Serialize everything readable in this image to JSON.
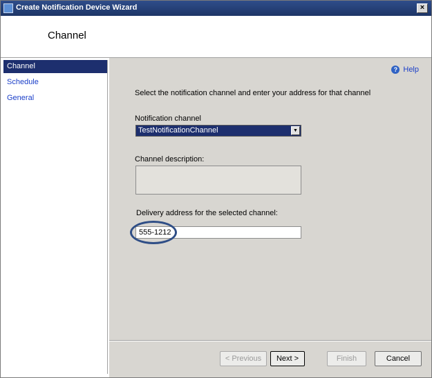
{
  "window": {
    "title": "Create Notification Device Wizard",
    "close_label": "×"
  },
  "header": {
    "page_title": "Channel"
  },
  "sidebar": {
    "items": [
      {
        "label": "Channel"
      },
      {
        "label": "Schedule"
      },
      {
        "label": "General"
      }
    ]
  },
  "content": {
    "help_label": "Help",
    "help_icon": "?",
    "instruction": "Select the notification channel and enter your address for that channel",
    "notification_channel_label": "Notification channel",
    "notification_channel_value": "TestNotificationChannel",
    "channel_description_label": "Channel description:",
    "channel_description_value": "",
    "delivery_address_label": "Delivery address for the selected channel:",
    "delivery_address_value": "555-1212"
  },
  "footer": {
    "previous_label": "< Previous",
    "next_label": "Next >",
    "finish_label": "Finish",
    "cancel_label": "Cancel"
  },
  "colors": {
    "title_bar": "#1d3566",
    "selection": "#1d2f6e",
    "panel": "#d8d6d1",
    "link": "#1a3ec8",
    "highlight_ring": "#2f4e86"
  }
}
